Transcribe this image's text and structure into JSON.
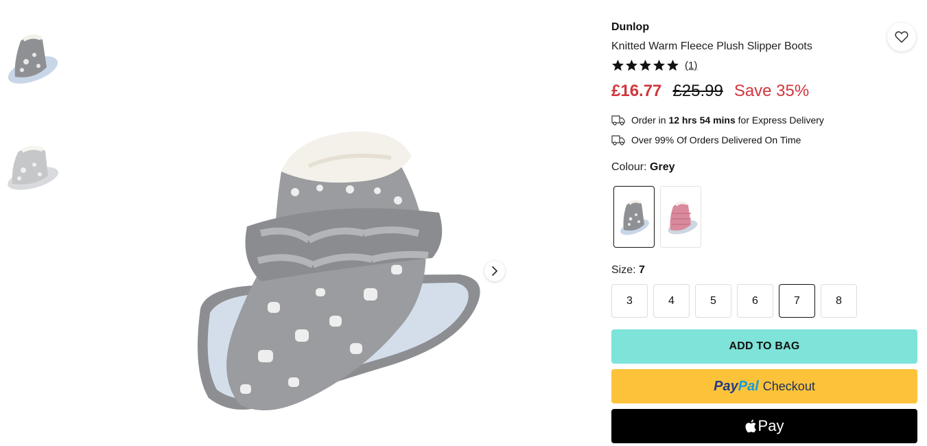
{
  "thumbnails": [
    {
      "alt": "grey-boot-thumbnail"
    },
    {
      "alt": "grey-boot-thumbnail-light"
    }
  ],
  "product": {
    "brand": "Dunlop",
    "title": "Knitted Warm Fleece Plush Slipper Boots",
    "rating": 5,
    "review_count": "(1)",
    "price_now": "£16.77",
    "price_was": "£25.99",
    "price_save": "Save 35%"
  },
  "delivery": {
    "line1_prefix": "Order in ",
    "line1_time": "12 hrs 54 mins",
    "line1_suffix": " for Express Delivery",
    "line2": "Over 99% Of Orders Delivered On Time"
  },
  "colour": {
    "label": "Colour: ",
    "selected": "Grey",
    "options": [
      "Grey",
      "Pink"
    ]
  },
  "size": {
    "label": "Size: ",
    "selected": "7",
    "options": [
      "3",
      "4",
      "5",
      "6",
      "7",
      "8"
    ]
  },
  "actions": {
    "add_to_bag": "ADD TO BAG",
    "paypal_pay": "Pay",
    "paypal_pal": "Pal",
    "paypal_checkout": "Checkout",
    "apple_pay": "Pay"
  },
  "colors": {
    "price_red": "#d0363d",
    "add_to_bag_bg": "#7ee3d8",
    "paypal_bg": "#fcc33a",
    "apple_bg": "#000000",
    "boot_grey": "#9a9c9f",
    "boot_pink": "#d98a9c"
  }
}
